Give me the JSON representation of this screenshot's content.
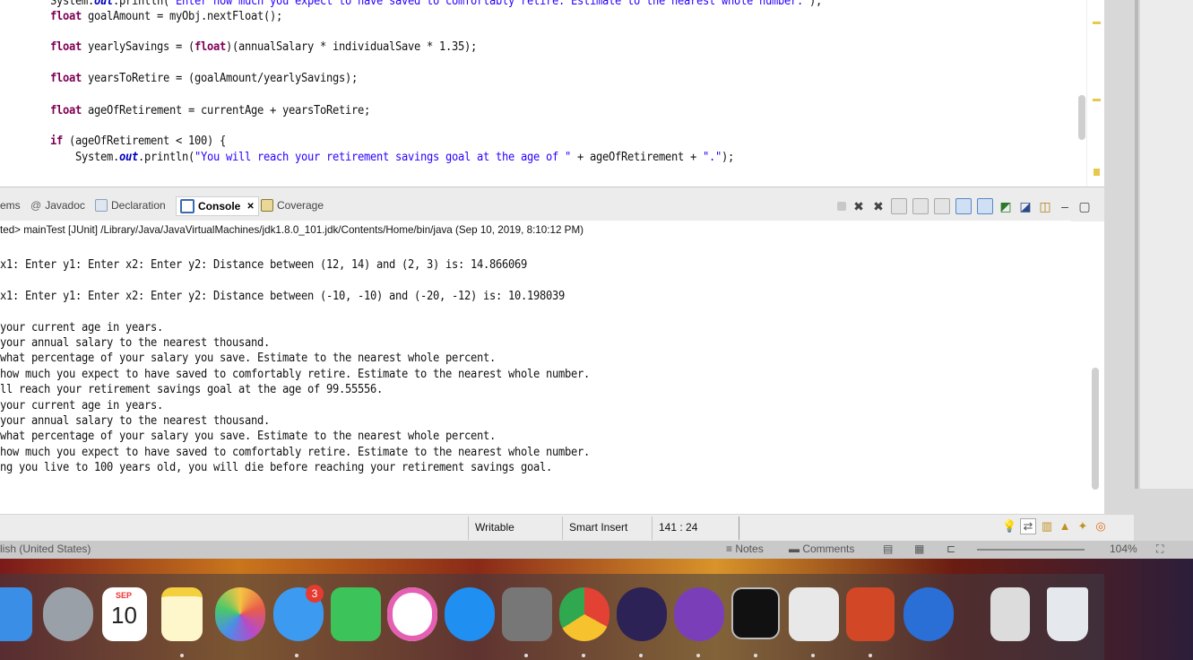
{
  "editor": {
    "lines": [
      {
        "indent": "        ",
        "parts": [
          {
            "t": "System.",
            "c": ""
          },
          {
            "t": "out",
            "c": "fld"
          },
          {
            "t": ".println(",
            "c": ""
          },
          {
            "t": "\"Enter how much you expect to have saved to comfortably retire. Estimate to the nearest whole number.\"",
            "c": "str"
          },
          {
            "t": ");",
            "c": ""
          }
        ]
      },
      {
        "indent": "        ",
        "parts": [
          {
            "t": "float",
            "c": "kw"
          },
          {
            "t": " goalAmount = myObj.nextFloat();",
            "c": ""
          }
        ]
      },
      {
        "indent": "        ",
        "parts": [
          {
            "t": "float",
            "c": "kw"
          },
          {
            "t": " yearlySavings = (",
            "c": ""
          },
          {
            "t": "float",
            "c": "kw"
          },
          {
            "t": ")(annualSalary * individualSave * 1.35);",
            "c": ""
          }
        ]
      },
      {
        "indent": "        ",
        "parts": [
          {
            "t": "float",
            "c": "kw"
          },
          {
            "t": " yearsToRetire = (goalAmount/yearlySavings);",
            "c": ""
          }
        ]
      },
      {
        "indent": "        ",
        "parts": [
          {
            "t": "float",
            "c": "kw"
          },
          {
            "t": " ageOfRetirement = currentAge + yearsToRetire;",
            "c": ""
          }
        ]
      },
      {
        "indent": "        ",
        "parts": [
          {
            "t": "if",
            "c": "kw"
          },
          {
            "t": " (ageOfRetirement < 100) {",
            "c": ""
          }
        ]
      },
      {
        "indent": "            ",
        "parts": [
          {
            "t": "System.",
            "c": ""
          },
          {
            "t": "out",
            "c": "fld"
          },
          {
            "t": ".println(",
            "c": ""
          },
          {
            "t": "\"You will reach your retirement savings goal at the age of \"",
            "c": "str"
          },
          {
            "t": " + ageOfRetirement + ",
            "c": ""
          },
          {
            "t": "\".\"",
            "c": "str"
          },
          {
            "t": ");",
            "c": ""
          }
        ]
      }
    ]
  },
  "console_tabs": {
    "problems": "ems",
    "javadoc": "Javadoc",
    "declaration": "Declaration",
    "console": "Console",
    "console_close": "✕",
    "coverage": "Coverage"
  },
  "console": {
    "header": "ted> mainTest [JUnit] /Library/Java/JavaVirtualMachines/jdk1.8.0_101.jdk/Contents/Home/bin/java (Sep 10, 2019, 8:10:12 PM)",
    "output": [
      "x1: Enter y1: Enter x2: Enter y2: Distance between (12, 14) and (2, 3) is: 14.866069",
      "",
      "x1: Enter y1: Enter x2: Enter y2: Distance between (-10, -10) and (-20, -12) is: 10.198039",
      "",
      "your current age in years.",
      "your annual salary to the nearest thousand.",
      "what percentage of your salary you save. Estimate to the nearest whole percent.",
      "how much you expect to have saved to comfortably retire. Estimate to the nearest whole number.",
      "ll reach your retirement savings goal at the age of 99.55556.",
      "your current age in years.",
      "your annual salary to the nearest thousand.",
      "what percentage of your salary you save. Estimate to the nearest whole percent.",
      "how much you expect to have saved to comfortably retire. Estimate to the nearest whole number.",
      "ng you live to 100 years old, you will die before reaching your retirement savings goal."
    ]
  },
  "status_bar": {
    "writable": "Writable",
    "insert_mode": "Smart Insert",
    "position": "141 : 24"
  },
  "powerpoint_strip": {
    "language": "lish (United States)",
    "notes": "Notes",
    "comments": "Comments",
    "zoom": "104%"
  },
  "dock": {
    "calendar_month": "SEP",
    "calendar_day": "10",
    "messages_badge": "3",
    "apps": [
      "finder",
      "launchpad",
      "calendar",
      "notes",
      "photos",
      "messages",
      "facetime",
      "itunes",
      "app-store",
      "system-preferences",
      "chrome",
      "eclipse",
      "github-desktop",
      "terminal",
      "preview",
      "powerpoint",
      "quicktime",
      "archive-utility",
      "trash"
    ]
  },
  "colors": {
    "keyword": "#7f0055",
    "string": "#2a00ff",
    "field": "#0000c0"
  }
}
